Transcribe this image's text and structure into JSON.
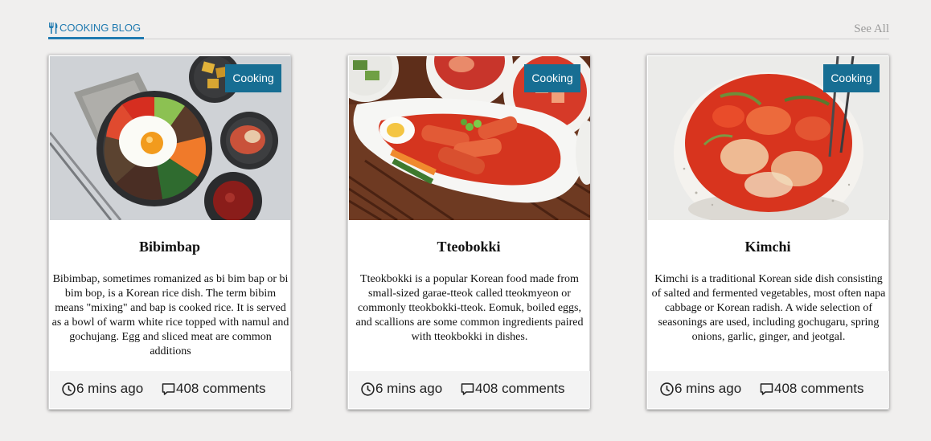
{
  "header": {
    "section_title": "COOKING BLOG",
    "section_icon": "fork-knife-icon",
    "see_all_label": "See All"
  },
  "colors": {
    "accent": "#1f7ab0",
    "badge": "#176e93",
    "background": "#f0efee"
  },
  "cards": [
    {
      "title": "Bibimbap",
      "badge": "Cooking",
      "image": "bibimbap-photo",
      "description": "Bibimbap, sometimes romanized as bi bim bap or bi bim bop, is a Korean rice dish. The term bibim means \"mixing\" and bap is cooked rice. It is served as a bowl of warm white rice topped with namul and gochujang. Egg and sliced meat are common additions",
      "time": "6 mins ago",
      "comments": "408 comments"
    },
    {
      "title": "Tteobokki",
      "badge": "Cooking",
      "image": "tteokbokki-photo",
      "description": "Tteokbokki is a popular Korean food made from small-sized garae-tteok called tteokmyeon or commonly tteokbokki-tteok. Eomuk, boiled eggs, and scallions are some common ingredients paired with tteokbokki in dishes.",
      "time": "6 mins ago",
      "comments": "408 comments"
    },
    {
      "title": "Kimchi",
      "badge": "Cooking",
      "image": "kimchi-photo",
      "description": "Kimchi is a traditional Korean side dish consisting of salted and fermented vegetables, most often napa cabbage or Korean radish. A wide selection of seasonings are used, including gochugaru, spring onions, garlic, ginger, and jeotgal.",
      "time": "6 mins ago",
      "comments": "408 comments"
    }
  ]
}
